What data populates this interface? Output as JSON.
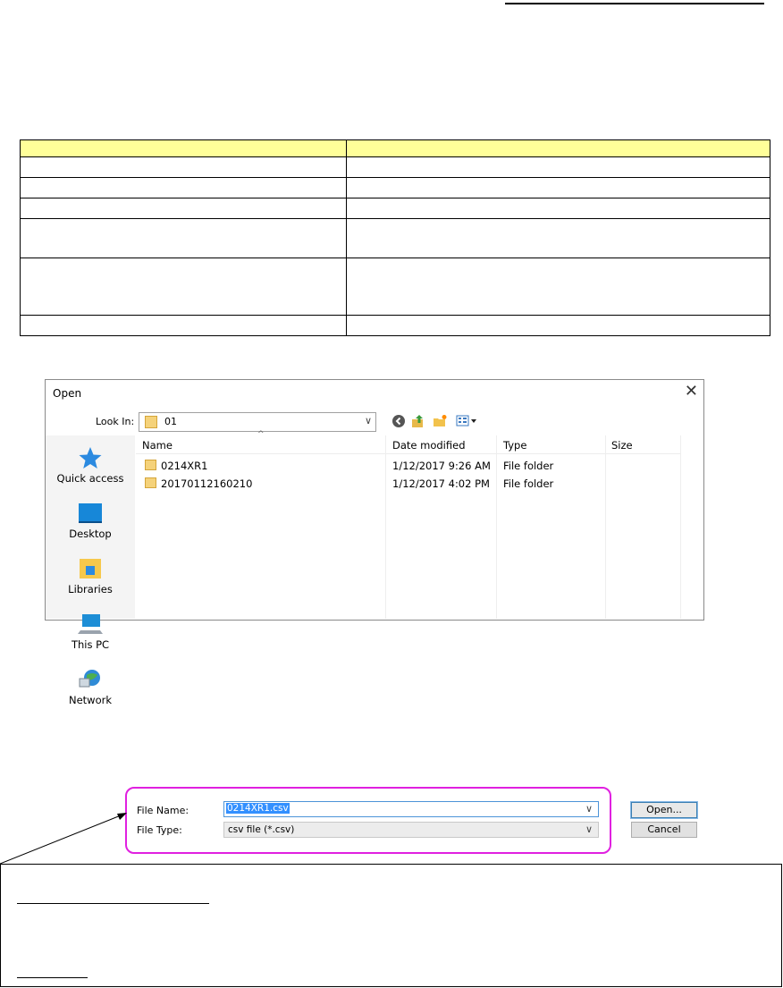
{
  "dialog": {
    "title": "Open",
    "close_icon": "close-icon",
    "look_in_label": "Look In:",
    "look_in_value": "01",
    "toolbar_icons": [
      "back-icon",
      "up-folder-icon",
      "new-folder-icon",
      "view-menu-icon"
    ],
    "places": [
      {
        "label": "Quick access",
        "icon": "star-icon"
      },
      {
        "label": "Desktop",
        "icon": "desktop-icon"
      },
      {
        "label": "Libraries",
        "icon": "libraries-icon"
      },
      {
        "label": "This PC",
        "icon": "computer-icon"
      },
      {
        "label": "Network",
        "icon": "network-icon"
      }
    ],
    "columns": [
      "Name",
      "Date modified",
      "Type",
      "Size"
    ],
    "files": [
      {
        "name": "0214XR1",
        "date": "1/12/2017 9:26 AM",
        "type": "File folder",
        "size": ""
      },
      {
        "name": "20170112160210",
        "date": "1/12/2017 4:02 PM",
        "type": "File folder",
        "size": ""
      }
    ],
    "file_name_label": "File Name:",
    "file_name_value": "0214XR1.csv",
    "file_type_label": "File Type:",
    "file_type_value": "csv file (*.csv)",
    "open_button": "Open...",
    "cancel_button": "Cancel"
  },
  "colors": {
    "table_header": "#ffff99",
    "highlight": "#e020e0",
    "selection": "#3390ff"
  }
}
